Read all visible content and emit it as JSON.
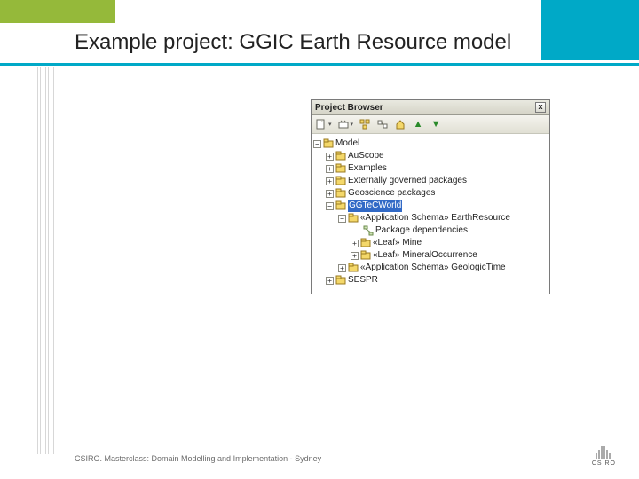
{
  "slide": {
    "title": "Example project: GGIC Earth Resource model",
    "footer": "CSIRO.  Masterclass: Domain Modelling and Implementation - Sydney",
    "logo_text": "CSIRO"
  },
  "panel": {
    "title": "Project Browser",
    "close_glyph": "x",
    "toolbar": {
      "new": "new",
      "new_caret": "▾",
      "wizard": "wizard",
      "wizard_caret": "▾",
      "packages": "packages",
      "link": "link",
      "home": "home",
      "arrow_up": "▲",
      "arrow_down": "▼"
    },
    "tree": {
      "root": "Model",
      "items": [
        {
          "label": "AuScope"
        },
        {
          "label": "Examples"
        },
        {
          "label": "Externally governed packages"
        },
        {
          "label": "Geoscience packages"
        },
        {
          "label": "GGTeCWorld",
          "expanded": true,
          "selected": true,
          "children": [
            {
              "label": "«Application Schema» EarthResource",
              "expanded": true,
              "children": [
                {
                  "label": "Package dependencies",
                  "leaf_icon": "diagram"
                },
                {
                  "label": "«Leaf» Mine"
                },
                {
                  "label": "«Leaf» MineralOccurrence"
                }
              ]
            },
            {
              "label": "«Application Schema» GeologicTime"
            }
          ]
        },
        {
          "label": "SESPR"
        }
      ]
    }
  }
}
